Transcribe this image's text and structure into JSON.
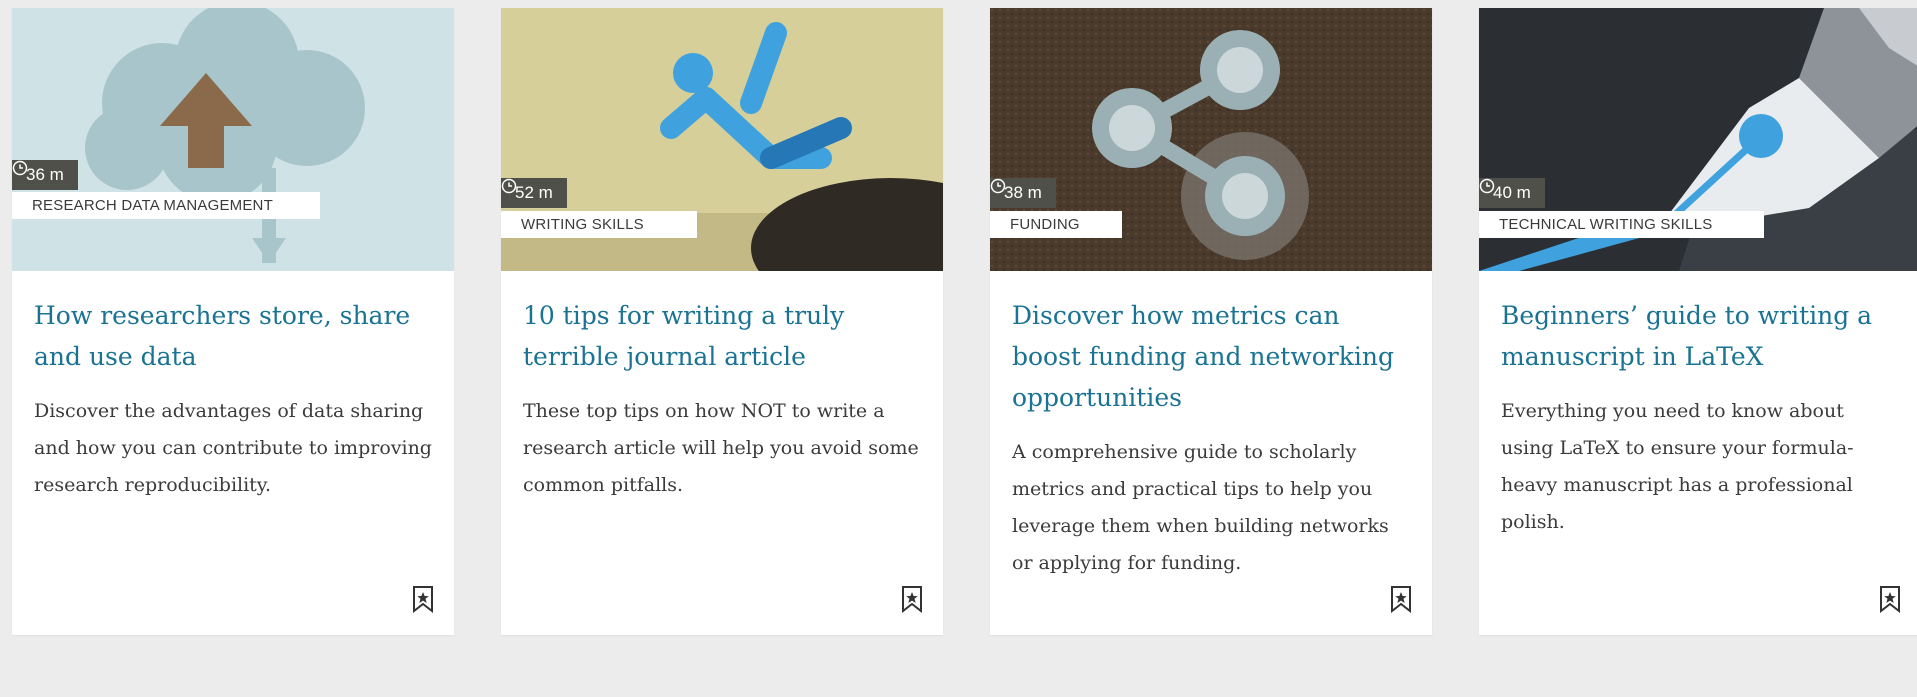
{
  "cards": [
    {
      "duration": "36 m",
      "category": "RESEARCH DATA MANAGEMENT",
      "title": "How researchers store, share and use data",
      "description": "Discover the advantages of data sharing and how you can contribute to improving research reproducibility.",
      "image_icon": "cloud-upload-illustration",
      "bookmark_icon": "bookmark-star-icon"
    },
    {
      "duration": "52 m",
      "category": "WRITING SKILLS",
      "title": "10 tips for writing a truly terrible journal article",
      "description": "These top tips on how NOT to write a research article will help you avoid some common pitfalls.",
      "image_icon": "falling-figure-illustration",
      "bookmark_icon": "bookmark-star-icon"
    },
    {
      "duration": "38 m",
      "category": "FUNDING",
      "title": "Discover how metrics can boost funding and networking opportunities",
      "description": "A comprehensive guide to scholarly metrics and practical tips to help you leverage them when building networks or applying for funding.",
      "image_icon": "network-share-illustration",
      "bookmark_icon": "bookmark-star-icon"
    },
    {
      "duration": "40 m",
      "category": "TECHNICAL WRITING SKILLS",
      "title": "Beginners’ guide to writing a manuscript in LaTeX",
      "description": "Everything you need to know about using LaTeX to ensure your formula-heavy manuscript has a professional polish.",
      "image_icon": "fountain-pen-illustration",
      "bookmark_icon": "bookmark-star-icon"
    }
  ],
  "colors": {
    "title": "#1a7393",
    "badge_bg": "#50504b",
    "page_bg": "#ececec"
  }
}
